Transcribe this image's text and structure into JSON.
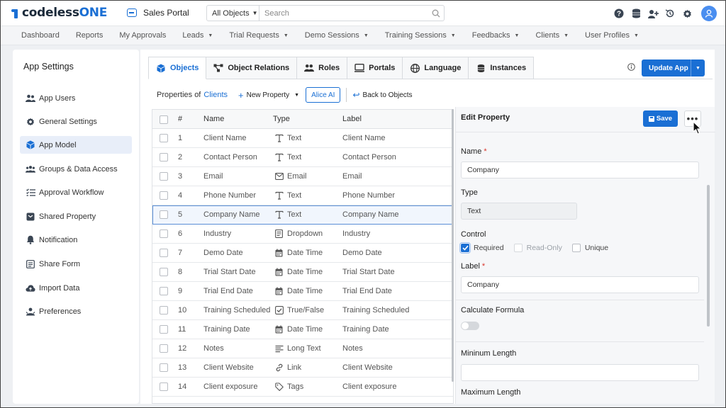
{
  "brand": {
    "name_prefix": "codeless",
    "name_suffix": "ONE"
  },
  "app": {
    "name": "Sales Portal"
  },
  "search": {
    "scope": "All Objects",
    "placeholder": "Search"
  },
  "top_icons": [
    "help-icon",
    "database-icon",
    "add-user-icon",
    "history-icon",
    "settings-icon",
    "user-avatar-icon"
  ],
  "nav": [
    {
      "label": "Dashboard",
      "dropdown": false
    },
    {
      "label": "Reports",
      "dropdown": false
    },
    {
      "label": "My Approvals",
      "dropdown": false
    },
    {
      "label": "Leads",
      "dropdown": true
    },
    {
      "label": "Trial Requests",
      "dropdown": true
    },
    {
      "label": "Demo Sessions",
      "dropdown": true
    },
    {
      "label": "Training Sessions",
      "dropdown": true
    },
    {
      "label": "Feedbacks",
      "dropdown": true
    },
    {
      "label": "Clients",
      "dropdown": true
    },
    {
      "label": "User Profiles",
      "dropdown": true
    }
  ],
  "sidebar": {
    "title": "App Settings",
    "items": [
      {
        "label": "App Users",
        "icon": "users-icon"
      },
      {
        "label": "General Settings",
        "icon": "gear-icon"
      },
      {
        "label": "App Model",
        "icon": "cube-icon",
        "active": true
      },
      {
        "label": "Groups & Data Access",
        "icon": "group-icon"
      },
      {
        "label": "Approval Workflow",
        "icon": "checklist-icon"
      },
      {
        "label": "Shared Property",
        "icon": "shared-icon"
      },
      {
        "label": "Notification",
        "icon": "bell-icon"
      },
      {
        "label": "Share Form",
        "icon": "form-icon"
      },
      {
        "label": "Import Data",
        "icon": "cloud-upload-icon"
      },
      {
        "label": "Preferences",
        "icon": "preferences-icon"
      }
    ]
  },
  "tabs": [
    {
      "label": "Objects",
      "icon": "cube-icon",
      "active": true
    },
    {
      "label": "Object Relations",
      "icon": "relations-icon"
    },
    {
      "label": "Roles",
      "icon": "roles-icon"
    },
    {
      "label": "Portals",
      "icon": "portal-icon"
    },
    {
      "label": "Language",
      "icon": "globe-icon"
    },
    {
      "label": "Instances",
      "icon": "database-icon"
    }
  ],
  "update_button": {
    "label": "Update App"
  },
  "toolbar": {
    "properties_of": "Properties of",
    "object_name": "Clients",
    "new_property": "New Property",
    "alice": "Alice AI",
    "back": "Back to Objects"
  },
  "table": {
    "headers": {
      "num": "#",
      "name": "Name",
      "type": "Type",
      "label": "Label"
    },
    "rows": [
      {
        "num": "1",
        "name": "Client Name",
        "type": "Text",
        "type_icon": "text-icon",
        "label": "Client Name"
      },
      {
        "num": "2",
        "name": "Contact Person",
        "type": "Text",
        "type_icon": "text-icon",
        "label": "Contact Person"
      },
      {
        "num": "3",
        "name": "Email",
        "type": "Email",
        "type_icon": "email-icon",
        "label": "Email"
      },
      {
        "num": "4",
        "name": "Phone Number",
        "type": "Text",
        "type_icon": "text-icon",
        "label": "Phone Number"
      },
      {
        "num": "5",
        "name": "Company Name",
        "type": "Text",
        "type_icon": "text-icon",
        "label": "Company Name",
        "selected": true
      },
      {
        "num": "6",
        "name": "Industry",
        "type": "Dropdown",
        "type_icon": "dropdown-icon",
        "label": "Industry"
      },
      {
        "num": "7",
        "name": "Demo Date",
        "type": "Date Time",
        "type_icon": "calendar-icon",
        "label": "Demo Date"
      },
      {
        "num": "8",
        "name": "Trial Start Date",
        "type": "Date Time",
        "type_icon": "calendar-icon",
        "label": "Trial Start Date"
      },
      {
        "num": "9",
        "name": "Trial End Date",
        "type": "Date Time",
        "type_icon": "calendar-icon",
        "label": "Trial End Date"
      },
      {
        "num": "10",
        "name": "Training Scheduled",
        "type": "True/False",
        "type_icon": "checkbox-icon",
        "label": "Training Scheduled"
      },
      {
        "num": "11",
        "name": "Training Date",
        "type": "Date Time",
        "type_icon": "calendar-icon",
        "label": "Training Date"
      },
      {
        "num": "12",
        "name": "Notes",
        "type": "Long Text",
        "type_icon": "long-text-icon",
        "label": "Notes"
      },
      {
        "num": "13",
        "name": "Client Website",
        "type": "Link",
        "type_icon": "link-icon",
        "label": "Client Website"
      },
      {
        "num": "14",
        "name": "Client exposure",
        "type": "Tags",
        "type_icon": "tag-icon",
        "label": "Client exposure"
      }
    ]
  },
  "edit": {
    "title": "Edit Property",
    "save": "Save",
    "more": "•••",
    "name_label": "Name",
    "name_value": "Company",
    "type_label": "Type",
    "type_value": "Text",
    "control_label": "Control",
    "control_options": [
      {
        "label": "Required",
        "checked": true,
        "disabled": false
      },
      {
        "label": "Read-Only",
        "checked": false,
        "disabled": true
      },
      {
        "label": "Unique",
        "checked": false,
        "disabled": false
      }
    ],
    "label_label": "Label",
    "label_value": "Company",
    "formula_label": "Calculate Formula",
    "formula_on": false,
    "min_label": "Mininum Length",
    "min_value": "",
    "max_label": "Maximum Length"
  },
  "colors": {
    "accent": "#1a6fd4",
    "required": "#d9342b"
  }
}
